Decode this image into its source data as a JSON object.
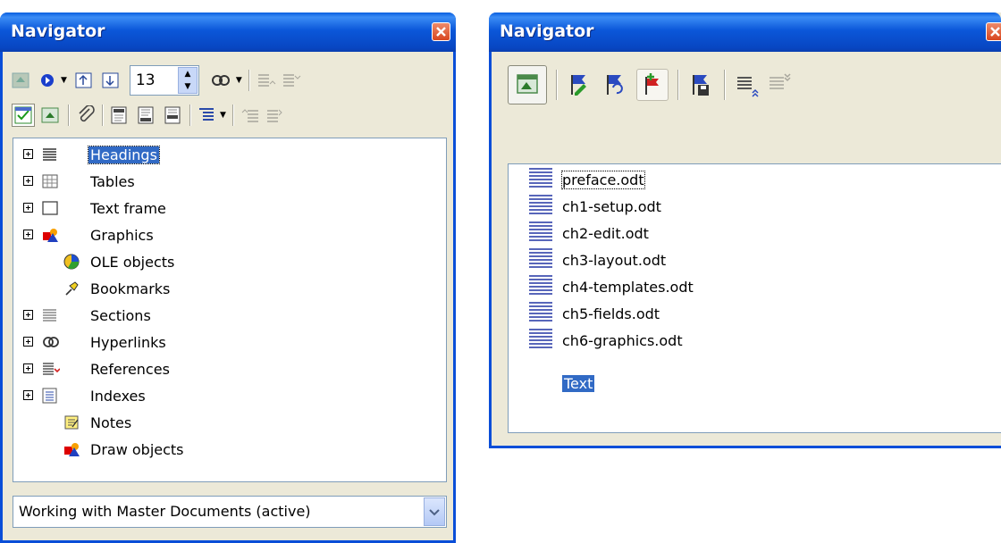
{
  "left_window": {
    "title": "Navigator",
    "spin_value": "13",
    "tree_items": [
      {
        "label": "Headings",
        "expandable": true,
        "icon": "headings-icon",
        "selected": true
      },
      {
        "label": "Tables",
        "expandable": true,
        "icon": "table-icon"
      },
      {
        "label": "Text frame",
        "expandable": true,
        "icon": "frame-icon"
      },
      {
        "label": "Graphics",
        "expandable": true,
        "icon": "graphics-icon"
      },
      {
        "label": "OLE objects",
        "expandable": false,
        "icon": "ole-icon"
      },
      {
        "label": "Bookmarks",
        "expandable": false,
        "icon": "bookmark-icon"
      },
      {
        "label": "Sections",
        "expandable": true,
        "icon": "sections-icon"
      },
      {
        "label": "Hyperlinks",
        "expandable": true,
        "icon": "hyperlink-icon"
      },
      {
        "label": "References",
        "expandable": true,
        "icon": "references-icon"
      },
      {
        "label": "Indexes",
        "expandable": true,
        "icon": "indexes-icon"
      },
      {
        "label": "Notes",
        "expandable": false,
        "icon": "notes-icon"
      },
      {
        "label": "Draw objects",
        "expandable": false,
        "icon": "draw-icon"
      }
    ],
    "document_select": "Working with Master Documents (active)"
  },
  "right_window": {
    "title": "Navigator",
    "files": [
      "preface.odt",
      "ch1-setup.odt",
      "ch2-edit.odt",
      "ch3-layout.odt",
      "ch4-templates.odt",
      "ch5-fields.odt",
      "ch6-graphics.odt"
    ],
    "text_item": "Text"
  },
  "colors": {
    "titlebar": "#0a57d9",
    "selection": "#316ac5",
    "window_bg": "#ece9d8"
  }
}
